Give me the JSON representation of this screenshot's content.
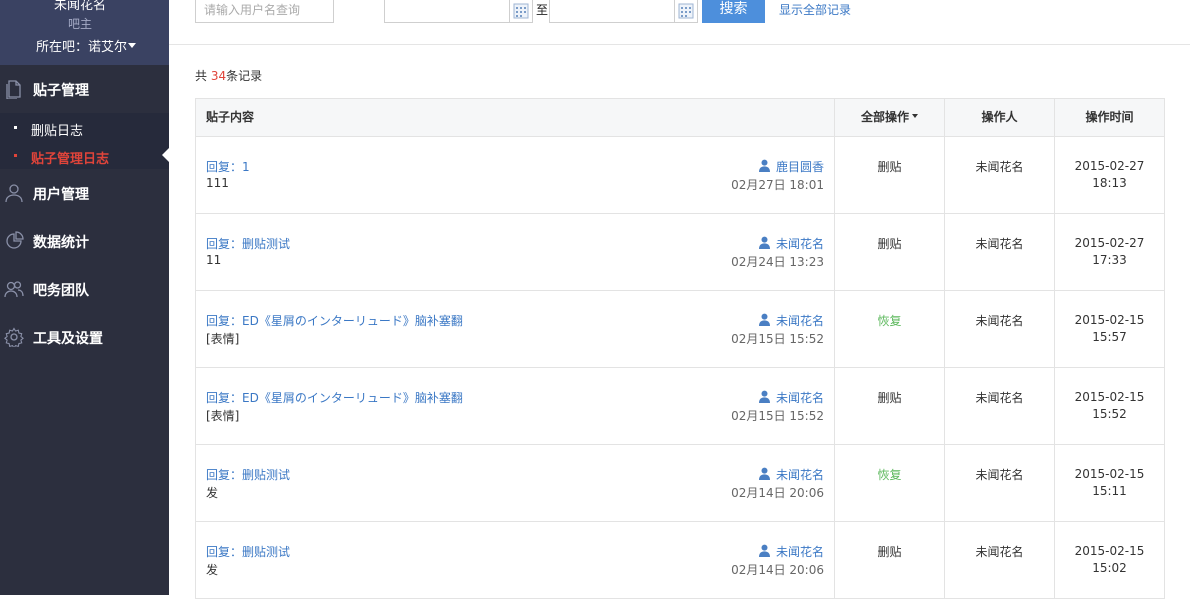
{
  "sidebar": {
    "username": "未闻花名",
    "role": "吧主",
    "forum_label": "所在吧：",
    "forum_name": "诺艾尔",
    "sections": [
      {
        "label": "贴子管理",
        "icon": "document-icon"
      },
      {
        "label": "用户管理",
        "icon": "user-icon"
      },
      {
        "label": "数据统计",
        "icon": "pie-chart-icon"
      },
      {
        "label": "吧务团队",
        "icon": "team-icon"
      },
      {
        "label": "工具及设置",
        "icon": "gear-icon"
      }
    ],
    "sub_items": [
      {
        "label": "删贴日志",
        "active": false
      },
      {
        "label": "贴子管理日志",
        "active": true
      }
    ]
  },
  "filter": {
    "user_placeholder": "请输入用户名查询",
    "date_separator": "至",
    "search_label": "搜索",
    "show_all_label": "显示全部记录"
  },
  "summary": {
    "prefix": "共",
    "count": "34",
    "suffix": "条记录"
  },
  "table": {
    "headers": {
      "content": "贴子内容",
      "ops": "全部操作",
      "operator": "操作人",
      "time": "操作时间"
    },
    "rows": [
      {
        "title": "回复：1",
        "body": "111",
        "author": "鹿目圆香",
        "post_date": "02月27日 18:01",
        "op": "删贴",
        "op_type": "delete",
        "operator": "未闻花名",
        "date": "2015-02-27",
        "time": "18:13"
      },
      {
        "title": "回复：删贴测试",
        "body": "11",
        "author": "未闻花名",
        "post_date": "02月24日 13:23",
        "op": "删贴",
        "op_type": "delete",
        "operator": "未闻花名",
        "date": "2015-02-27",
        "time": "17:33"
      },
      {
        "title": "回复：ED《星屑のインターリュード》脑补塞翻",
        "body": "[表情]",
        "author": "未闻花名",
        "post_date": "02月15日 15:52",
        "op": "恢复",
        "op_type": "restore",
        "operator": "未闻花名",
        "date": "2015-02-15",
        "time": "15:57"
      },
      {
        "title": "回复：ED《星屑のインターリュード》脑补塞翻",
        "body": "[表情]",
        "author": "未闻花名",
        "post_date": "02月15日 15:52",
        "op": "删贴",
        "op_type": "delete",
        "operator": "未闻花名",
        "date": "2015-02-15",
        "time": "15:52"
      },
      {
        "title": "回复：删贴测试",
        "body": "发",
        "author": "未闻花名",
        "post_date": "02月14日 20:06",
        "op": "恢复",
        "op_type": "restore",
        "operator": "未闻花名",
        "date": "2015-02-15",
        "time": "15:11"
      },
      {
        "title": "回复：删贴测试",
        "body": "发",
        "author": "未闻花名",
        "post_date": "02月14日 20:06",
        "op": "删贴",
        "op_type": "delete",
        "operator": "未闻花名",
        "date": "2015-02-15",
        "time": "15:02"
      }
    ]
  },
  "colors": {
    "sidebar_bg": "#2c2f3e",
    "user_box_bg": "#3a4262",
    "accent_red": "#e0443a",
    "link_blue": "#3b78c5",
    "restore_green": "#5cb85c",
    "button_blue": "#4d8fdc"
  }
}
